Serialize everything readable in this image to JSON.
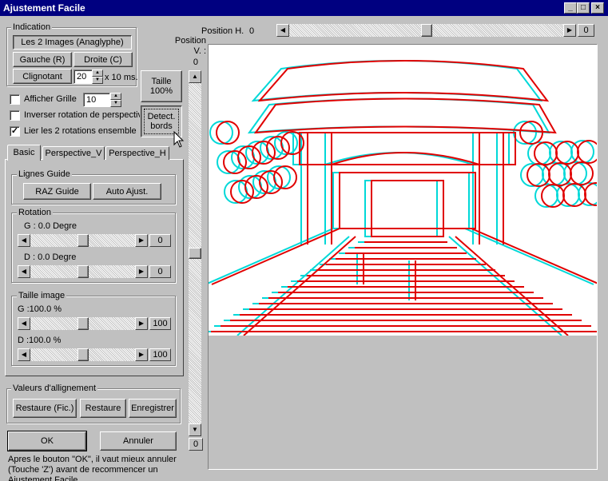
{
  "window": {
    "title": "Ajustement Facile",
    "min": "_",
    "max": "□",
    "close": "×"
  },
  "indication": {
    "label": "Indication",
    "anaglyph": "Les 2 Images (Anaglyphe)",
    "gauche": "Gauche (R)",
    "droite": "Droite (C)",
    "clignotant": "Clignotant",
    "interval_value": "20",
    "interval_unit": "x 10 ms."
  },
  "taille_button": "Taille\n100%",
  "detect_button": "Detect.\nbords",
  "options": {
    "afficher_grille": {
      "label": "Afficher Grille",
      "checked": false,
      "value": "10"
    },
    "inverser": {
      "label": "Inverser rotation de perspectiv",
      "checked": false
    },
    "lier": {
      "label": "Lier les 2 rotations ensemble",
      "checked": true
    }
  },
  "tabs": [
    {
      "label": "Basic",
      "active": true
    },
    {
      "label": "Perspective_V",
      "active": false
    },
    {
      "label": "Perspective_H",
      "active": false
    }
  ],
  "lignes_guide": {
    "label": "Lignes Guide",
    "raz": "RAZ Guide",
    "auto": "Auto Ajust."
  },
  "rotation": {
    "label": "Rotation",
    "g_label": "G : 0.0 Degre",
    "g_value": "0",
    "g_pos": 0.5,
    "d_label": "D : 0.0 Degre",
    "d_value": "0",
    "d_pos": 0.5
  },
  "taille_image": {
    "label": "Taille image",
    "g_label": "G :100.0 %",
    "g_value": "100",
    "g_pos": 0.5,
    "d_label": "D :100.0 %",
    "d_value": "100",
    "d_pos": 0.5
  },
  "valeurs": {
    "label": "Valeurs d'allignement",
    "restaure_fic": "Restaure (Fic.)",
    "restaure": "Restaure",
    "enregistrer": "Enregistrer"
  },
  "ok": "OK",
  "annuler": "Annuler",
  "note": "Apres le bouton \"OK\", il vaut mieux annuler (Touche 'Z') avant de recommencer un Ajustement Facile.",
  "position_h": {
    "label": "Position H.",
    "value": "0",
    "box": "0",
    "pos": 0.5
  },
  "position_v": {
    "label": "Position\nV. :",
    "value": "0",
    "box": "0",
    "pos": 0.5
  },
  "colors": {
    "title_bg": "#000080",
    "face": "#c0c0c0",
    "anaglyph_red": "#e00000",
    "anaglyph_cyan": "#00e0e0"
  }
}
